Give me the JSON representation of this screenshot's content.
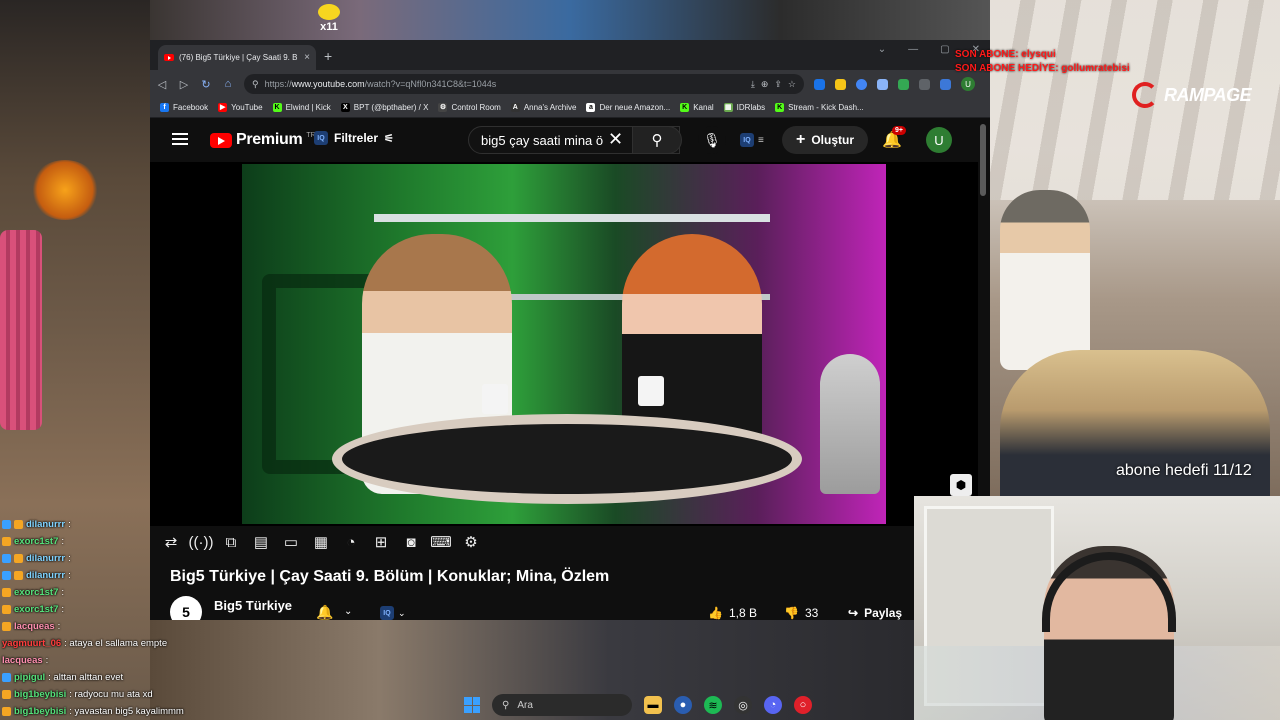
{
  "browser": {
    "tab_title": "(76) Big5 Türkiye | Çay Saati 9. B",
    "tab_close": "×",
    "new_tab": "+",
    "url_prefix": "https://",
    "url_host": "www.youtube.com",
    "url_path": "/watch?v=qNfl0n341C8&t=1044s",
    "profile_initial": "U",
    "window_controls": [
      "⌄",
      "—",
      "▢",
      "✕"
    ]
  },
  "bookmarks": [
    {
      "label": "Facebook",
      "color": "#1877f2",
      "glyph": "f"
    },
    {
      "label": "YouTube",
      "color": "#ff0000",
      "glyph": "▶"
    },
    {
      "label": "Elwind | Kick",
      "color": "#53fc18",
      "glyph": "K"
    },
    {
      "label": "BPT (@bpthaber) / X",
      "color": "#000000",
      "glyph": "X"
    },
    {
      "label": "Control Room",
      "color": "#444444",
      "glyph": "⚙"
    },
    {
      "label": "Anna's Archive",
      "color": "#333333",
      "glyph": "A"
    },
    {
      "label": "Der neue Amazon...",
      "color": "#ffffff",
      "glyph": "a"
    },
    {
      "label": "Kanal",
      "color": "#53fc18",
      "glyph": "K"
    },
    {
      "label": "IDRlabs",
      "color": "#6aa84f",
      "glyph": "▦"
    },
    {
      "label": "Stream - Kick Dash...",
      "color": "#53fc18",
      "glyph": "K"
    }
  ],
  "youtube": {
    "logo_text": "Premium",
    "logo_region": "TR",
    "filters_label": "Filtreler",
    "iq_label": "IQ",
    "search_value": "big5 çay saati mina ö",
    "create_label": "Oluştur",
    "notif_badge": "9+",
    "user_initial": "U",
    "video_title": "Big5 Türkiye | Çay Saati 9. Bölüm | Konuklar; Mina, Özlem",
    "channel_name": "Big5 Türkiye",
    "channel_initial": "5",
    "likes": "1,8 B",
    "dislikes": "33",
    "share_label": "Paylaş"
  },
  "overlay": {
    "sub_line1": "SON ABONE: elysqui",
    "sub_line2": "SON ABONE HEDİYE: gollumratebisi",
    "brand": "RAMPAGE",
    "sub_goal": "abone hedefi 11/12",
    "emote_count": "x11"
  },
  "chat": [
    {
      "user": "dilanurrr",
      "color": "#7fd3ff",
      "msg": ":"
    },
    {
      "user": "exorc1st7",
      "color": "#54e07a",
      "msg": ":"
    },
    {
      "user": "dilanurrr",
      "color": "#7fd3ff",
      "msg": ":"
    },
    {
      "user": "dilanurrr",
      "color": "#7fd3ff",
      "msg": ":"
    },
    {
      "user": "exorc1st7",
      "color": "#54e07a",
      "msg": ":"
    },
    {
      "user": "exorc1st7",
      "color": "#54e07a",
      "msg": ":"
    },
    {
      "user": "lacqueas",
      "color": "#ff8fb0",
      "msg": ":"
    },
    {
      "user": "yagmuurt_06",
      "color": "#ff3d3d",
      "msg": ": ataya el sallama empte"
    },
    {
      "user": "lacqueas",
      "color": "#ff8fb0",
      "msg": ":"
    },
    {
      "user": "pipigul",
      "color": "#54e07a",
      "msg": ": alttan alttan evet"
    },
    {
      "user": "big1beybisi",
      "color": "#54e07a",
      "msg": ": radyocu mu ata xd"
    },
    {
      "user": "big1beybisi",
      "color": "#54e07a",
      "msg": ": yavastan big5 kayalimmm"
    }
  ],
  "taskbar": {
    "search_label": "Ara"
  }
}
